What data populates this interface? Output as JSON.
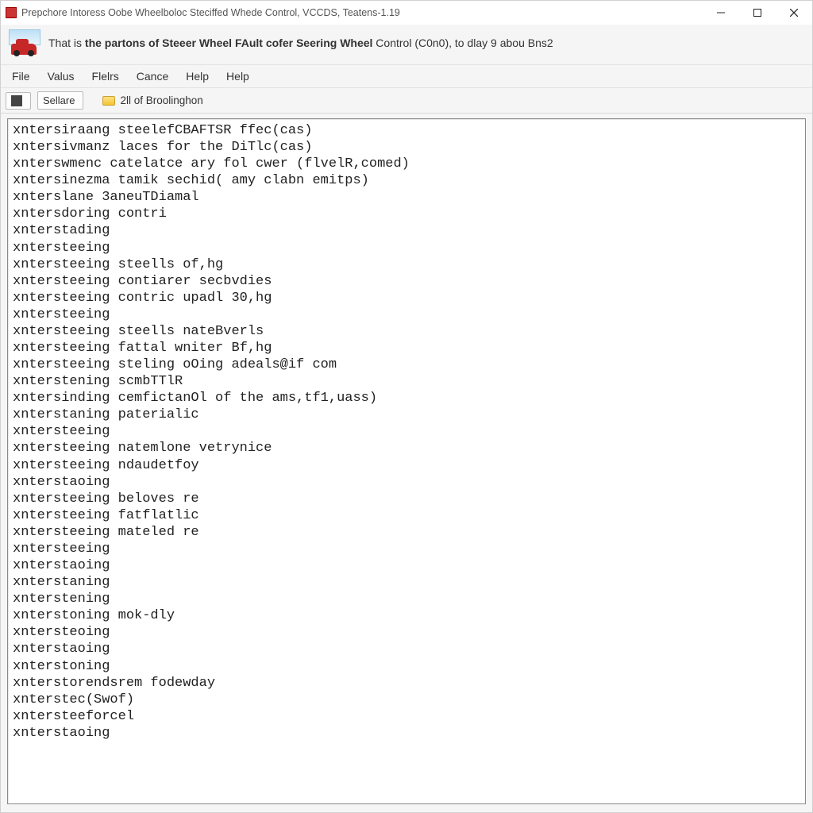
{
  "titlebar": {
    "title": "Prepchore Intoress Oobe Wheelboloc Steciffed Whede Control, VCCDS, Teatens-1.19"
  },
  "header": {
    "text_plain_prefix": "That is ",
    "text_bold": "the partons of Steeer Wheel FAult cofer Seering Wheel",
    "text_plain_suffix": " Control (C0n0), to dlay 9 abou Bns2"
  },
  "menu": {
    "items": [
      "File",
      "Valus",
      "Flelrs",
      "Cance",
      "Help",
      "Help"
    ]
  },
  "toolbar": {
    "sellare_label": "Sellare",
    "status_text": "2ll of Broolinghon"
  },
  "editor": {
    "lines": [
      "xntersiraang steelefCBAFTSR ffec(cas)",
      "xntersivmanz laces for the DiTlc(cas)",
      "xnterswmenc catelatce ary fol cwer (flvelR,comed)",
      "xntersinezma tamik sechid( amy clabn emitps)",
      "xnterslane 3aneuTDiamal",
      "xntersdoring contri",
      "xnterstading",
      "xntersteeing",
      "xntersteeing steells of,hg",
      "xntersteeing contiarer secbvdies",
      "xntersteeing contric upadl 30,hg",
      "xntersteeing",
      "xntersteeing steells nateBverls",
      "xntersteeing fattal wniter Bf,hg",
      "xntersteeing steling oOing adeals@if com",
      "xnterstening scmbTTlR",
      "xntersinding cemfictanOl of the ams,tf1,uass)",
      "xnterstaning paterialic",
      "xntersteeing",
      "xntersteeing natemlone vetrynice",
      "xntersteeing ndaudetfoy",
      "xnterstaoing",
      "xntersteeing beloves re",
      "xntersteeing fatflatlic",
      "xntersteeing mateled re",
      "xntersteeing",
      "xnterstaoing",
      "xnterstaning",
      "xnterstening",
      "xnterstoning mok-dly",
      "xntersteoing",
      "xnterstaoing",
      "xnterstoning",
      "xnterstorendsrem fodewday",
      "xnterstec(Swof)",
      "xntersteeforcel",
      "xnterstaoing"
    ]
  }
}
